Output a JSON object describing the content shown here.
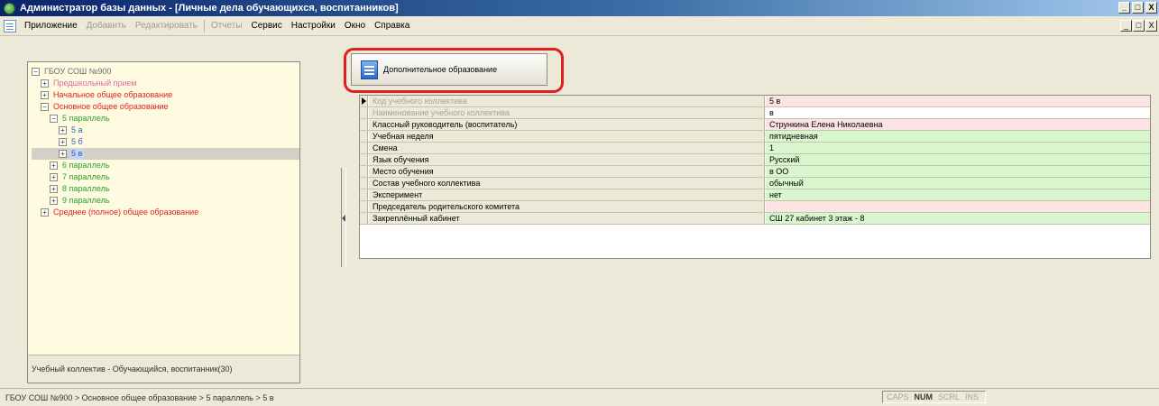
{
  "window": {
    "title": "Администратор базы данных - [Личные дела обучающихся, воспитанников]",
    "controls": [
      "_",
      "□",
      "X"
    ]
  },
  "menu": {
    "items": [
      {
        "label": "Приложение",
        "enabled": true
      },
      {
        "label": "Добавить",
        "enabled": false
      },
      {
        "label": "Редактировать",
        "enabled": false
      },
      {
        "label": "Отчеты",
        "enabled": false
      },
      {
        "label": "Сервис",
        "enabled": true
      },
      {
        "label": "Настройки",
        "enabled": true
      },
      {
        "label": "Окно",
        "enabled": true
      },
      {
        "label": "Справка",
        "enabled": true
      }
    ],
    "mdi_controls": [
      "_",
      "□",
      "X"
    ]
  },
  "tree": {
    "root": "ГБОУ СОШ №900",
    "nodes": [
      {
        "label": "Предшкольный прием",
        "expander": "+"
      },
      {
        "label": "Начальное общее образование",
        "expander": "+"
      },
      {
        "label": "Основное общее образование",
        "expander": "−"
      },
      {
        "label": "5 параллель",
        "expander": "−"
      },
      {
        "label": "5 а",
        "expander": "+"
      },
      {
        "label": "5 б",
        "expander": "+"
      },
      {
        "label": "5 в",
        "expander": "+"
      },
      {
        "label": "6 параллель",
        "expander": "+"
      },
      {
        "label": "7 параллель",
        "expander": "+"
      },
      {
        "label": "8 параллель",
        "expander": "+"
      },
      {
        "label": "9 параллель",
        "expander": "+"
      },
      {
        "label": "Среднее (полное) общее образование",
        "expander": "+"
      }
    ],
    "status": "Учебный коллектив - Обучающийся, воспитанник(30)"
  },
  "button": {
    "label": "Дополнительное образование"
  },
  "grid": {
    "rows": [
      {
        "label": "Код учебного коллектива",
        "value": "5 в"
      },
      {
        "label": "Наименование учебного коллектива",
        "value": "в"
      },
      {
        "label": "Классный руководитель (воспитатель)",
        "value": "Стрункина Елена Николаевна"
      },
      {
        "label": "Учебная неделя",
        "value": "пятидневная"
      },
      {
        "label": "Смена",
        "value": "1"
      },
      {
        "label": "Язык обучения",
        "value": "Русский"
      },
      {
        "label": "Место обучения",
        "value": "в ОО"
      },
      {
        "label": "Состав учебного коллектива",
        "value": "обычный"
      },
      {
        "label": "Эксперимент",
        "value": "нет"
      },
      {
        "label": "Председатель родительского комитета",
        "value": ""
      },
      {
        "label": "Закреплённый кабинет",
        "value": "СШ 27 кабинет 3 этаж - 8"
      }
    ]
  },
  "statusbar": {
    "path": "ГБОУ СОШ №900 > Основное общее образование > 5 параллель > 5 в",
    "keys": [
      {
        "label": "CAPS",
        "active": false
      },
      {
        "label": "NUM",
        "active": true
      },
      {
        "label": "SCRL",
        "active": false
      },
      {
        "label": "INS",
        "active": false
      }
    ]
  },
  "colors": {
    "title_bar": "#0a246a",
    "highlight_outline": "#e02020",
    "value_pink": "#fde4e4",
    "value_green": "#d9f7cf",
    "tree_background": "#fffbe0"
  }
}
